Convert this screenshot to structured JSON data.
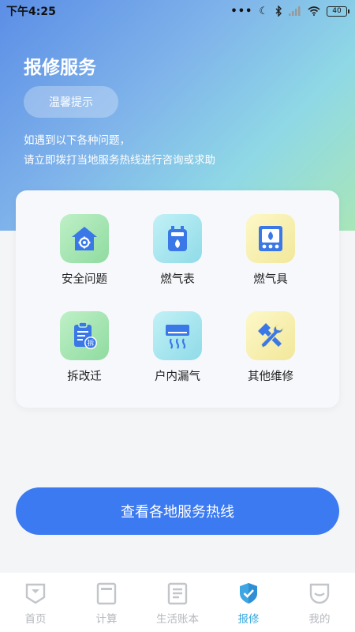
{
  "status": {
    "time": "下午4:25",
    "battery": "40"
  },
  "header": {
    "title": "报修服务",
    "tips_label": "温馨提示",
    "notice_line1": "如遇到以下各种问题，",
    "notice_line2": "请立即拨打当地服务热线进行咨询或求助"
  },
  "services": [
    {
      "label": "安全问题",
      "icon": "house-gear-icon"
    },
    {
      "label": "燃气表",
      "icon": "gas-meter-icon"
    },
    {
      "label": "燃气具",
      "icon": "gas-stove-icon"
    },
    {
      "label": "拆改迁",
      "icon": "relocation-document-icon"
    },
    {
      "label": "户内漏气",
      "icon": "indoor-leak-icon"
    },
    {
      "label": "其他维修",
      "icon": "repair-tools-icon"
    }
  ],
  "hotline_button": "查看各地服务热线",
  "tabs": [
    {
      "label": "首页",
      "icon": "home-icon"
    },
    {
      "label": "计算",
      "icon": "calculator-icon"
    },
    {
      "label": "生活账本",
      "icon": "ledger-icon"
    },
    {
      "label": "报修",
      "icon": "repair-shield-icon",
      "active": true
    },
    {
      "label": "我的",
      "icon": "profile-icon"
    }
  ],
  "colors": {
    "primary": "#3b7af1",
    "active_tab": "#39a8e0",
    "inactive_tab": "#b5b8bd"
  }
}
